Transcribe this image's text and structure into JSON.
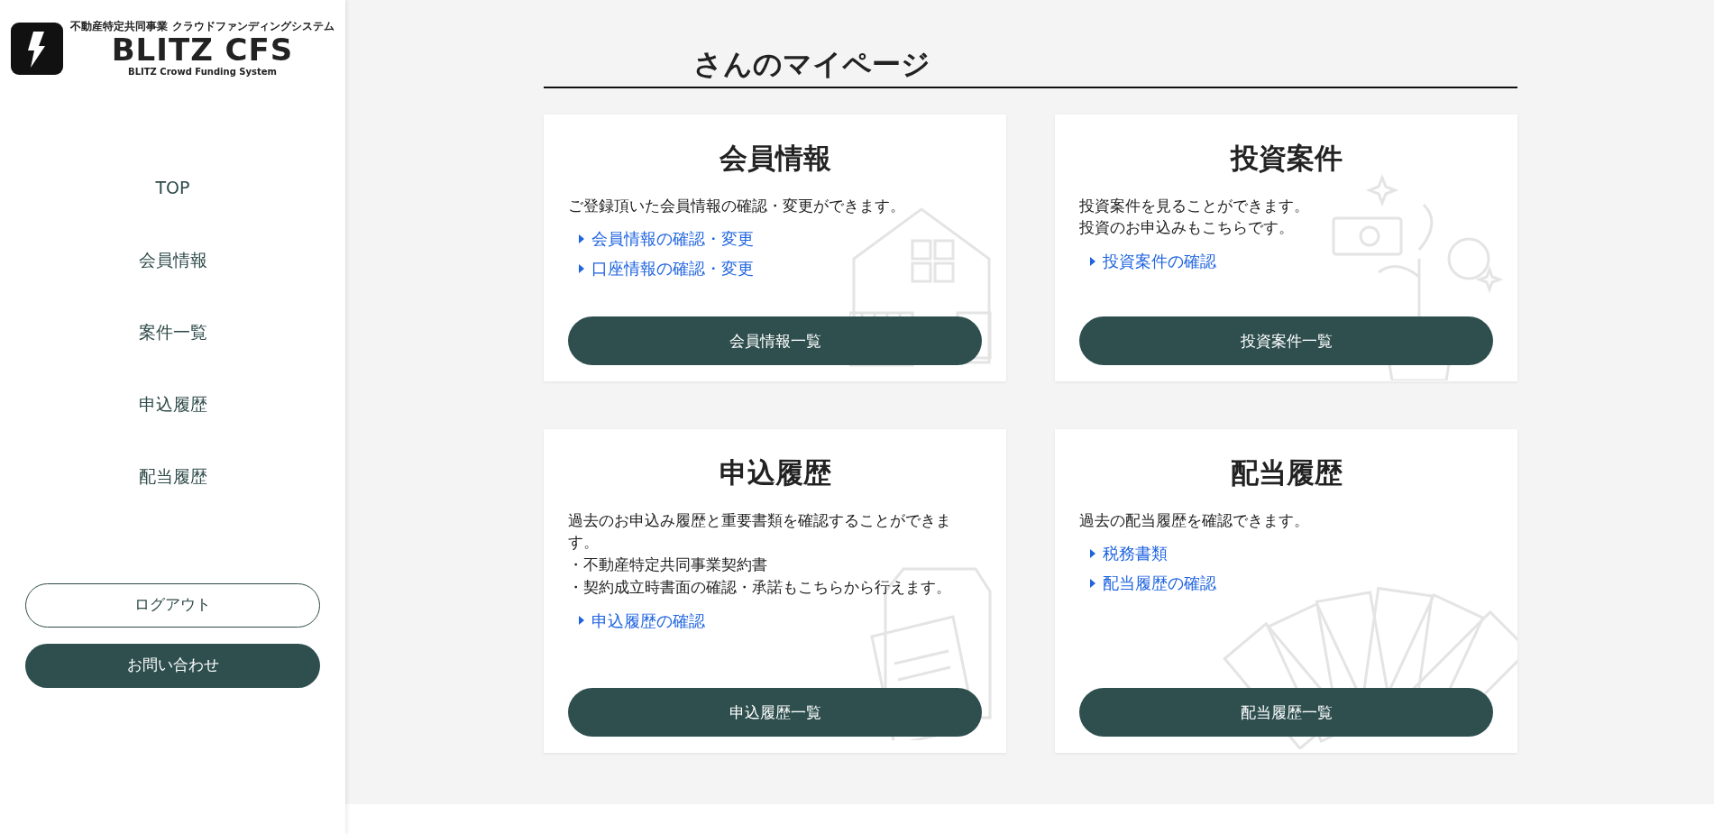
{
  "logo": {
    "tagline": "不動産特定共同事業 クラウドファンディングシステム",
    "name": "BLITZ CFS",
    "subtitle": "BLITZ Crowd Funding System"
  },
  "sidebar": {
    "items": [
      {
        "label": "TOP"
      },
      {
        "label": "会員情報"
      },
      {
        "label": "案件一覧"
      },
      {
        "label": "申込履歴"
      },
      {
        "label": "配当履歴"
      }
    ],
    "logout": "ログアウト",
    "contact": "お問い合わせ"
  },
  "page_title": "さんのマイページ",
  "cards": [
    {
      "title": "会員情報",
      "description": [
        "ご登録頂いた会員情報の確認・変更ができます。"
      ],
      "links": [
        "会員情報の確認・変更",
        "口座情報の確認・変更"
      ],
      "button": "会員情報一覧"
    },
    {
      "title": "投資案件",
      "description": [
        "投資案件を見ることができます。",
        "投資のお申込みもこちらです。"
      ],
      "links": [
        "投資案件の確認"
      ],
      "button": "投資案件一覧"
    },
    {
      "title": "申込履歴",
      "description": [
        "過去のお申込み履歴と重要書類を確認することができます。",
        "・不動産特定共同事業契約書",
        "・契約成立時書面の確認・承諾もこちらから行えます。"
      ],
      "links": [
        "申込履歴の確認"
      ],
      "button": "申込履歴一覧"
    },
    {
      "title": "配当履歴",
      "description": [
        "過去の配当履歴を確認できます。"
      ],
      "links": [
        "税務書類",
        "配当履歴の確認"
      ],
      "button": "配当履歴一覧"
    }
  ]
}
